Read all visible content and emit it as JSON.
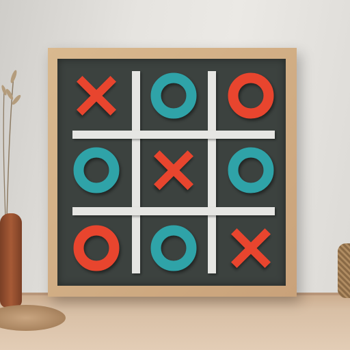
{
  "scene": {
    "subject": "tic-tac-toe-wall-board",
    "colors": {
      "board": "#3c423f",
      "frame": "#d2b087",
      "grid_lines": "#e6e6e3",
      "red": "#e8452e",
      "teal": "#2fa3a8"
    }
  },
  "board": {
    "cells": [
      {
        "mark": "X",
        "color": "red"
      },
      {
        "mark": "O",
        "color": "teal"
      },
      {
        "mark": "O",
        "color": "red"
      },
      {
        "mark": "O",
        "color": "teal"
      },
      {
        "mark": "X",
        "color": "red"
      },
      {
        "mark": "O",
        "color": "teal"
      },
      {
        "mark": "O",
        "color": "red"
      },
      {
        "mark": "O",
        "color": "teal"
      },
      {
        "mark": "X",
        "color": "red"
      }
    ]
  }
}
